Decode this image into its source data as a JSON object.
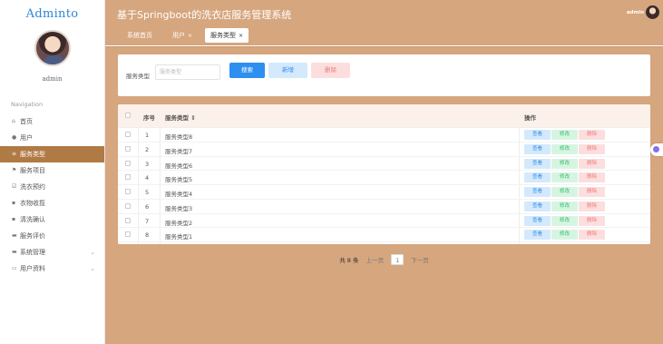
{
  "brand": "Adminto",
  "user": {
    "name": "admin"
  },
  "nav_title": "Navigation",
  "menu": [
    {
      "icon": "⌂",
      "label": "首页"
    },
    {
      "icon": "●",
      "label": "用户"
    },
    {
      "icon": "≡",
      "label": "服务类型",
      "active": true
    },
    {
      "icon": "⚑",
      "label": "服务项目"
    },
    {
      "icon": "☑",
      "label": "洗衣预约"
    },
    {
      "icon": "▪",
      "label": "衣物收揽"
    },
    {
      "icon": "▪",
      "label": "清洗确认"
    },
    {
      "icon": "▬",
      "label": "服务评价"
    },
    {
      "icon": "▬",
      "label": "系统管理",
      "expandable": true
    },
    {
      "icon": "▭",
      "label": "用户资料",
      "expandable": true
    }
  ],
  "header": {
    "title": "基于Springboot的洗衣店服务管理系统",
    "user": "admin"
  },
  "tabs": [
    {
      "label": "系统首页",
      "close": ""
    },
    {
      "label": "用户",
      "close": "×"
    },
    {
      "label": "服务类型",
      "close": "×",
      "active": true
    }
  ],
  "search": {
    "label": "服务类型",
    "placeholder": "服务类型",
    "search_btn": "搜索",
    "add_btn": "新增",
    "delete_btn": "删除"
  },
  "table": {
    "headers": {
      "index": "序号",
      "name": "服务类型 ⇕",
      "ops": "操作"
    },
    "rows": [
      {
        "index": "1",
        "name": "服务类型8"
      },
      {
        "index": "2",
        "name": "服务类型7"
      },
      {
        "index": "3",
        "name": "服务类型6"
      },
      {
        "index": "4",
        "name": "服务类型5"
      },
      {
        "index": "5",
        "name": "服务类型4"
      },
      {
        "index": "6",
        "name": "服务类型3"
      },
      {
        "index": "7",
        "name": "服务类型2"
      },
      {
        "index": "8",
        "name": "服务类型1"
      }
    ],
    "op_labels": {
      "view": "查看",
      "edit": "修改",
      "delete": "删除"
    }
  },
  "pagination": {
    "total": "共 8 条",
    "prev": "上一页",
    "page": "1",
    "next": "下一页"
  },
  "colors": {
    "accent": "#d6a67e",
    "active_menu": "#b07a45",
    "primary": "#2d8ff0"
  }
}
